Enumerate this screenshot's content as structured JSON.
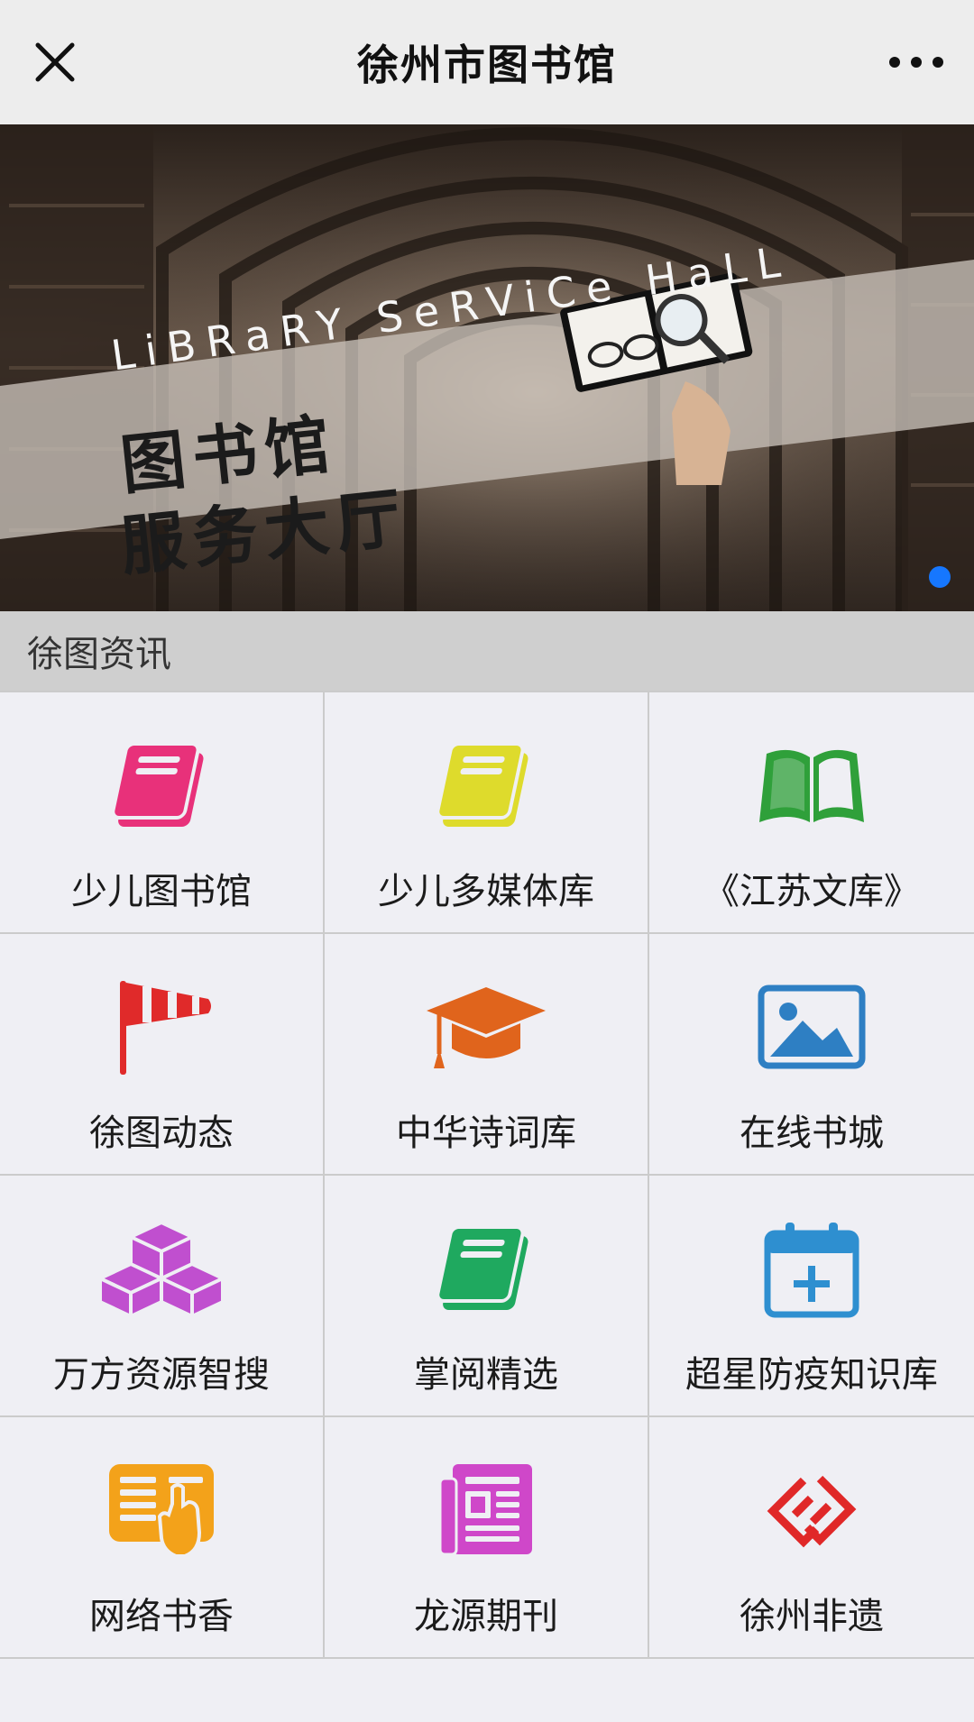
{
  "header": {
    "title": "徐州市图书馆"
  },
  "banner": {
    "subtitle_en": "LiBRaRY SeRViCe HaLL",
    "title_line1": "图书馆",
    "title_line2": "服务大厅"
  },
  "section": {
    "title": "徐图资讯"
  },
  "grid": [
    {
      "label": "少儿图书馆",
      "icon": "book-icon",
      "color": "#e8317a"
    },
    {
      "label": "少儿多媒体库",
      "icon": "book-icon",
      "color": "#dedb2c"
    },
    {
      "label": "《江苏文库》",
      "icon": "open-book-icon",
      "color": "#2fa03a"
    },
    {
      "label": "徐图动态",
      "icon": "windsock-icon",
      "color": "#e02a2a"
    },
    {
      "label": "中华诗词库",
      "icon": "graduation-cap-icon",
      "color": "#e0641c"
    },
    {
      "label": "在线书城",
      "icon": "image-icon",
      "color": "#2e7fc3"
    },
    {
      "label": "万方资源智搜",
      "icon": "cubes-icon",
      "color": "#c04fcf"
    },
    {
      "label": "掌阅精选",
      "icon": "book-icon",
      "color": "#1fa95f"
    },
    {
      "label": "超星防疫知识库",
      "icon": "calendar-plus-icon",
      "color": "#2e8fd0"
    },
    {
      "label": "网络书香",
      "icon": "reading-hand-icon",
      "color": "#f3a21a"
    },
    {
      "label": "龙源期刊",
      "icon": "newspaper-icon",
      "color": "#cf47c9"
    },
    {
      "label": "徐州非遗",
      "icon": "link-logo-icon",
      "color": "#e02828"
    }
  ]
}
